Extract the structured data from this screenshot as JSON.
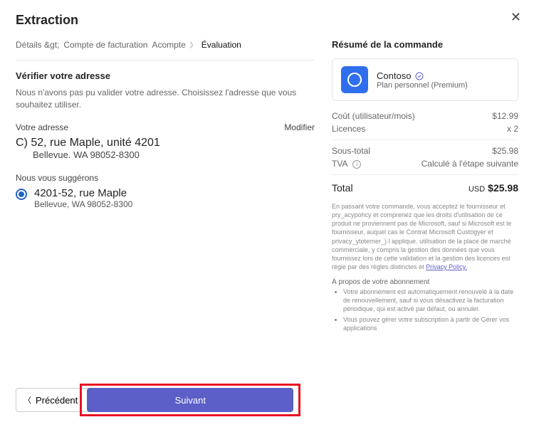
{
  "modal": {
    "title": "Extraction",
    "close_label": "✕"
  },
  "breadcrumb": {
    "step1": "Détails &gt;",
    "step2": "Compte de facturation",
    "step3": "Acompte",
    "step4": "Évaluation"
  },
  "left": {
    "verify_heading": "Vérifier votre adresse",
    "verify_desc": "Nous n'avons pas pu valider votre adresse. Choisissez l'adresse que vous souhaitez utiliser.",
    "your_address_label": "Votre adresse",
    "modify_label": "Modifier",
    "address": {
      "line1": "C) 52, rue Maple, unité 4201",
      "line2": "Bellevue. WA 98052-8300"
    },
    "suggest_label": "Nous vous suggérons",
    "suggested": {
      "line1": "4201-52, rue Maple",
      "line2": "Bellevue, WA 98052-8300"
    }
  },
  "footer": {
    "prev_label": "Précédent",
    "next_label": "Suivant"
  },
  "order": {
    "heading": "Résumé de la commande",
    "product_name": "Contoso",
    "product_plan": "Plan personnel (Premium)",
    "cost_label": "Coût (utilisateur/mois)",
    "cost_value": "$12.99",
    "licenses_label": "Licences",
    "licenses_value": "x 2",
    "subtotal_label": "Sous-total",
    "subtotal_value": "$25.98",
    "vat_label": "TVA",
    "vat_value": "Calculé à l'étape suivante",
    "total_label": "Total",
    "total_currency": "USD",
    "total_value": "$25.98",
    "legal_text": "En passant votre commande, vous acceptez le fournisseur et pry_acypohcy et comprenez que les droits d'utilisation de ce produit ne proviennent pas de Microsoft, sauf si Microsoft est le fournisseur, auquel cas le Contrat Microsoft Custogyer et privacy_ytoterner_) l applique. utilisation de la place de marché commerciale, y compris la gestion des données que vous fournissez lors de cette validation et la gestion des licences est régie par des règles distinctes et",
    "privacy_link": "Privacy Policy.",
    "about_heading": "À propos de votre abonnement",
    "about_item1": "Votre abonnement est automatiquement renouvelé à la date de renouvellement, sauf si vous désactivez la facturation périodique, qui est activé par défaut, ou annuler.",
    "about_item2": "Vous pouvez gérer votre subscription à partir de Gérer vos applications"
  }
}
